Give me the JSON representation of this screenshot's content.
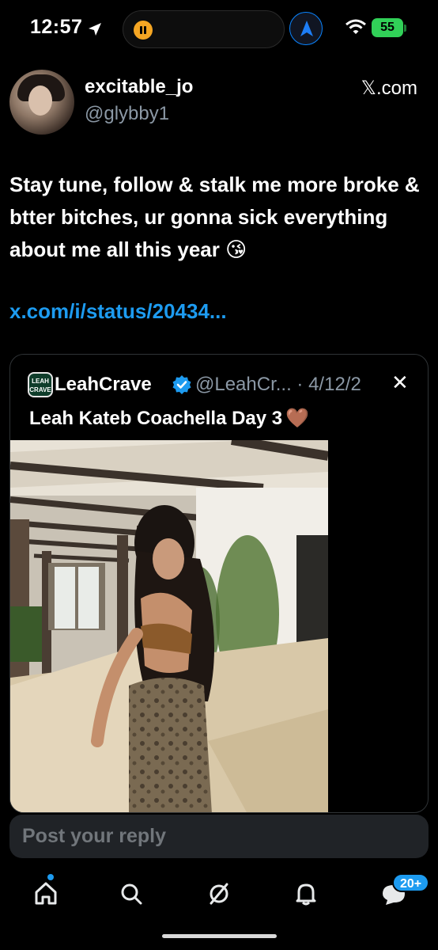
{
  "status_bar": {
    "time": "12:57",
    "battery": "55"
  },
  "tweet": {
    "display_name": "excitable_jo",
    "handle": "@glybby1",
    "source": "𝕏.com",
    "text": "Stay tune, follow & stalk me more broke & btter bitches, ur gonna sick everything about me all this year 😘",
    "link": "x.com/i/status/20434..."
  },
  "quoted_tweet": {
    "avatar_text": "LEAH CRAVE",
    "display_name": "LeahCrave",
    "handle_date": "@LeahCr... · 4/12/2",
    "close_glyph": "✕",
    "text": "Leah Kateb Coachella Day 3",
    "emoji": "🤎"
  },
  "reply": {
    "placeholder": "Post your reply"
  },
  "bottom_nav": {
    "items": [
      "home-icon",
      "search-icon",
      "grok-icon",
      "notifications-icon",
      "messages-icon"
    ],
    "messages_badge": "20+"
  },
  "colors": {
    "background": "#000000",
    "link_blue": "#1d9bf0",
    "secondary_text": "#8b98a5",
    "battery_green": "#31d158",
    "pause_orange": "#f5a623"
  }
}
